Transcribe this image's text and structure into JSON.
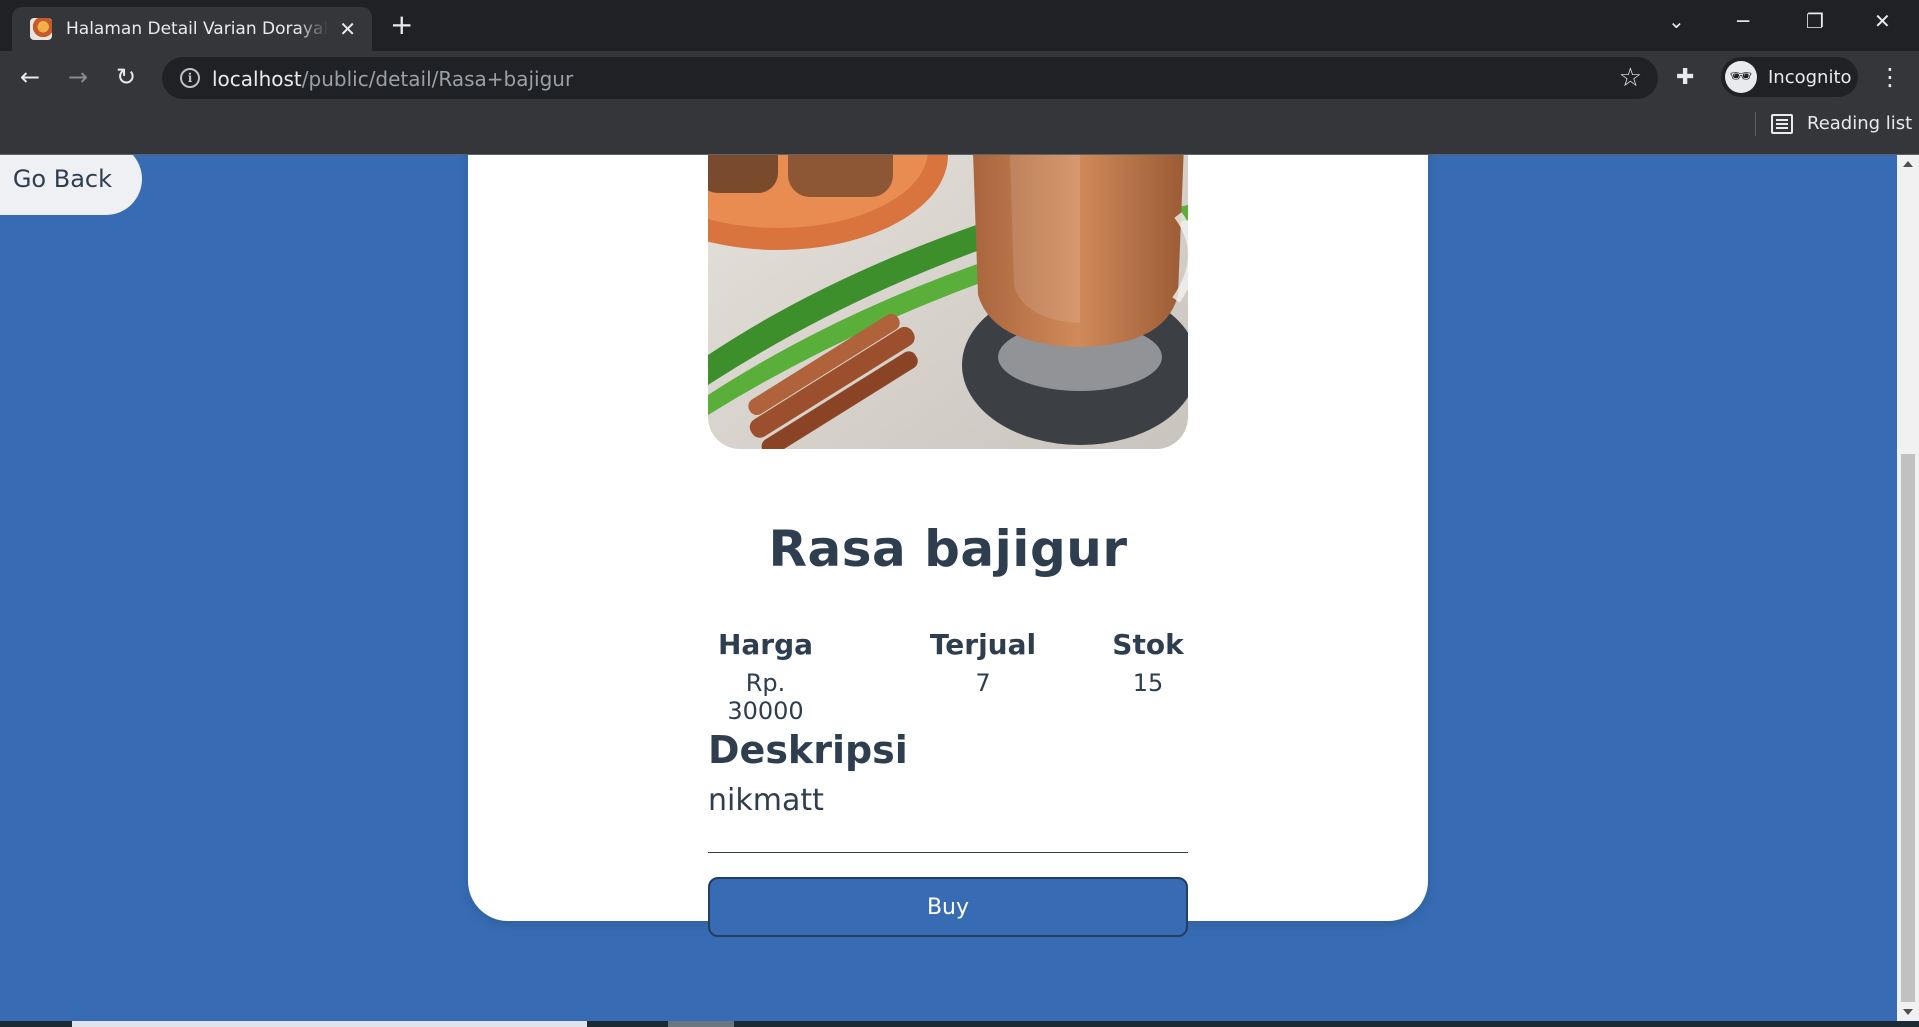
{
  "browser": {
    "tab_title": "Halaman Detail Varian Dorayaki Rasa bajigur",
    "url_host": "localhost",
    "url_path": "/public/detail/Rasa+bajigur",
    "profile_label": "Incognito",
    "reading_list_label": "Reading list",
    "icons": {
      "new_tab": "+",
      "close": "✕",
      "back": "←",
      "forward": "→",
      "reload": "↻",
      "star": "☆",
      "menu": "⋮",
      "info": "i",
      "extensions": "✚",
      "tab_search": "⌄",
      "minimize": "─",
      "restore": "❐",
      "window_close": "✕",
      "incognito": "🕶"
    }
  },
  "page": {
    "go_back_label": "Go Back",
    "product": {
      "name": "Rasa bajigur",
      "stats": [
        {
          "label": "Harga",
          "value": "Rp. 30000"
        },
        {
          "label": "Terjual",
          "value": "7"
        },
        {
          "label": "Stok",
          "value": "15"
        }
      ],
      "description_heading": "Deskripsi",
      "description": "nikmatt",
      "buy_label": "Buy"
    }
  },
  "colors": {
    "page_background": "#376cb4",
    "card": "#ffffff",
    "text": "#2f3e4e",
    "buy_button": "#376cb4"
  }
}
